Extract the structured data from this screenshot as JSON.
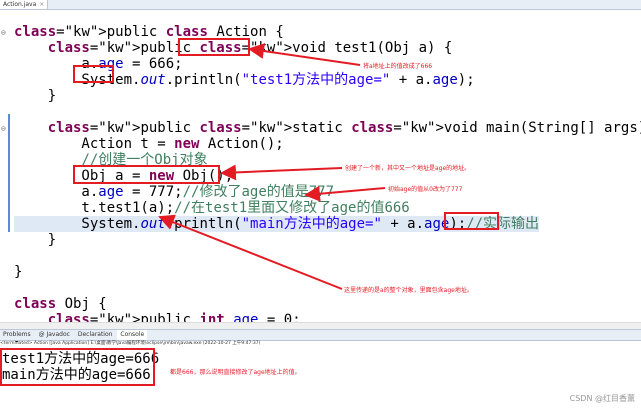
{
  "editor_tab": {
    "label": "Action.java",
    "close": "×"
  },
  "code_lines": [
    "public class Action {",
    "    public void test1(Obj a) {",
    "        a.age = 666;",
    "        System.out.println(\"test1方法中的age=\" + a.age);",
    "    }",
    "",
    "    public static void main(String[] args) {",
    "        Action t = new Action();",
    "        //创建一个Obj对象",
    "        Obj a = new Obj();",
    "        a.age = 777;//修改了age的值是777",
    "        t.test1(a);//在test1里面又修改了age的值666",
    "        System.out.println(\"main方法中的age=\" + a.age);//实际输出",
    "    }",
    "",
    "}",
    "",
    "class Obj {",
    "    public int age = 0;",
    "}"
  ],
  "annotations": {
    "a1": "将a地址上的值改成了666",
    "a2": "创建了一个新，其中又一个地址是age的地址。",
    "a3": "初始age的值从0改为了777",
    "a4": "这里传递的是a的整个对象，里面包含age地址。",
    "a5": "都是666，那么说明直接修改了age地址上的值。"
  },
  "view_tabs": [
    "Problems",
    "@ Javadoc",
    "Declaration",
    "Console"
  ],
  "terminated_line": "<terminated> Action [Java Application] E:\\桌面\\教学\\Java编程环境\\eclipse\\jre\\bin\\javaw.exe (2022-10-27 上午9:47:37)",
  "console_output": [
    "test1方法中的age=666",
    "main方法中的age=666"
  ],
  "watermark": "CSDN @红目香薰",
  "colors": {
    "annotation_red": "#e31b23",
    "keyword": "#7f0055",
    "field": "#0000c0",
    "string": "#2a00ff",
    "comment": "#3f7f5f"
  }
}
